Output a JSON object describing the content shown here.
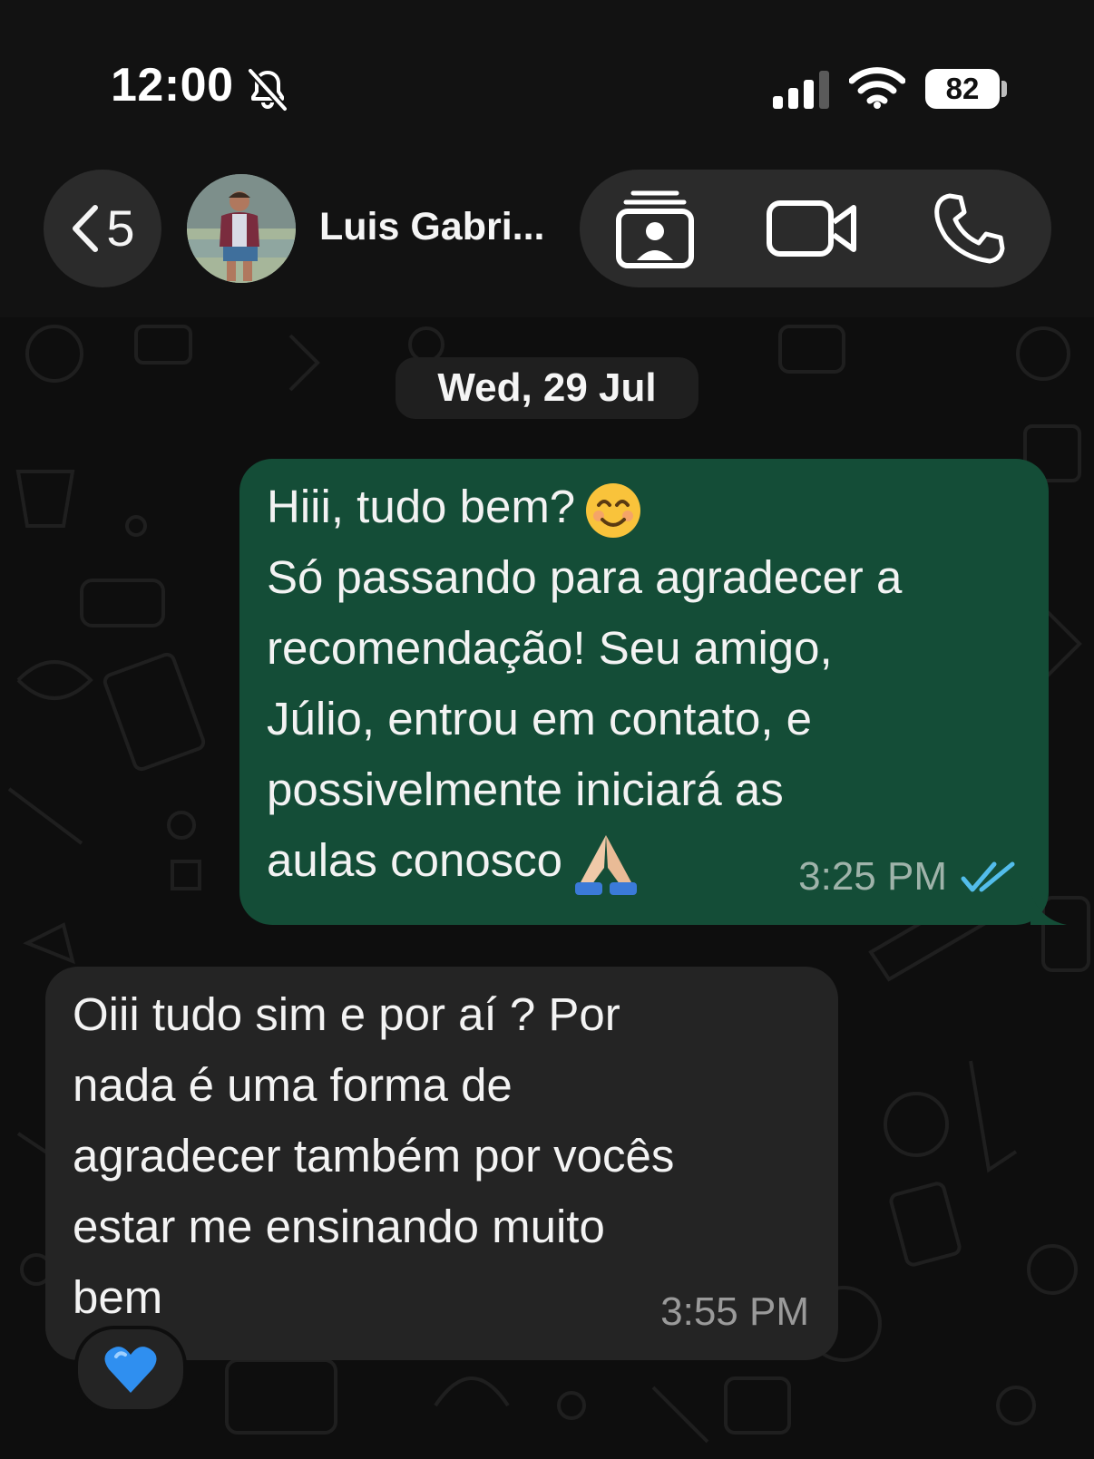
{
  "status_bar": {
    "time": "12:00",
    "battery": "82",
    "icons": [
      "bell-slash-icon",
      "cellular-signal-icon",
      "wifi-icon",
      "battery-icon"
    ]
  },
  "header": {
    "back_count": "5",
    "contact_name": "Luis Gabri...",
    "actions": [
      "contact-card-icon",
      "video-call-icon",
      "phone-call-icon"
    ]
  },
  "chat": {
    "date_label": "Wed, 29 Jul",
    "messages": [
      {
        "direction": "outgoing",
        "lines": [
          "Hiii, tudo bem?",
          "Só passando para agradecer a",
          "recomendação! Seu amigo,",
          "Júlio, entrou em contato, e",
          "possivelmente iniciará as",
          "aulas conosco"
        ],
        "emojis": [
          "smiling-face-emoji",
          "folded-hands-emoji"
        ],
        "time": "3:25 PM",
        "status": "read",
        "status_icon": "double-check-icon",
        "bubble_color": "#144d37"
      },
      {
        "direction": "incoming",
        "lines": [
          "Oiii tudo sim e por aí ? Por",
          "nada é uma forma de",
          "agradecer também por vocês",
          "estar me ensinando muito",
          "bem"
        ],
        "time": "3:55 PM",
        "reaction": "💙",
        "bubble_color": "#242424"
      }
    ]
  },
  "colors": {
    "background": "#0d0d0d",
    "header": "#121212",
    "outgoing_bubble": "#144d37",
    "incoming_bubble": "#242424",
    "read_ticks": "#53bdeb"
  }
}
